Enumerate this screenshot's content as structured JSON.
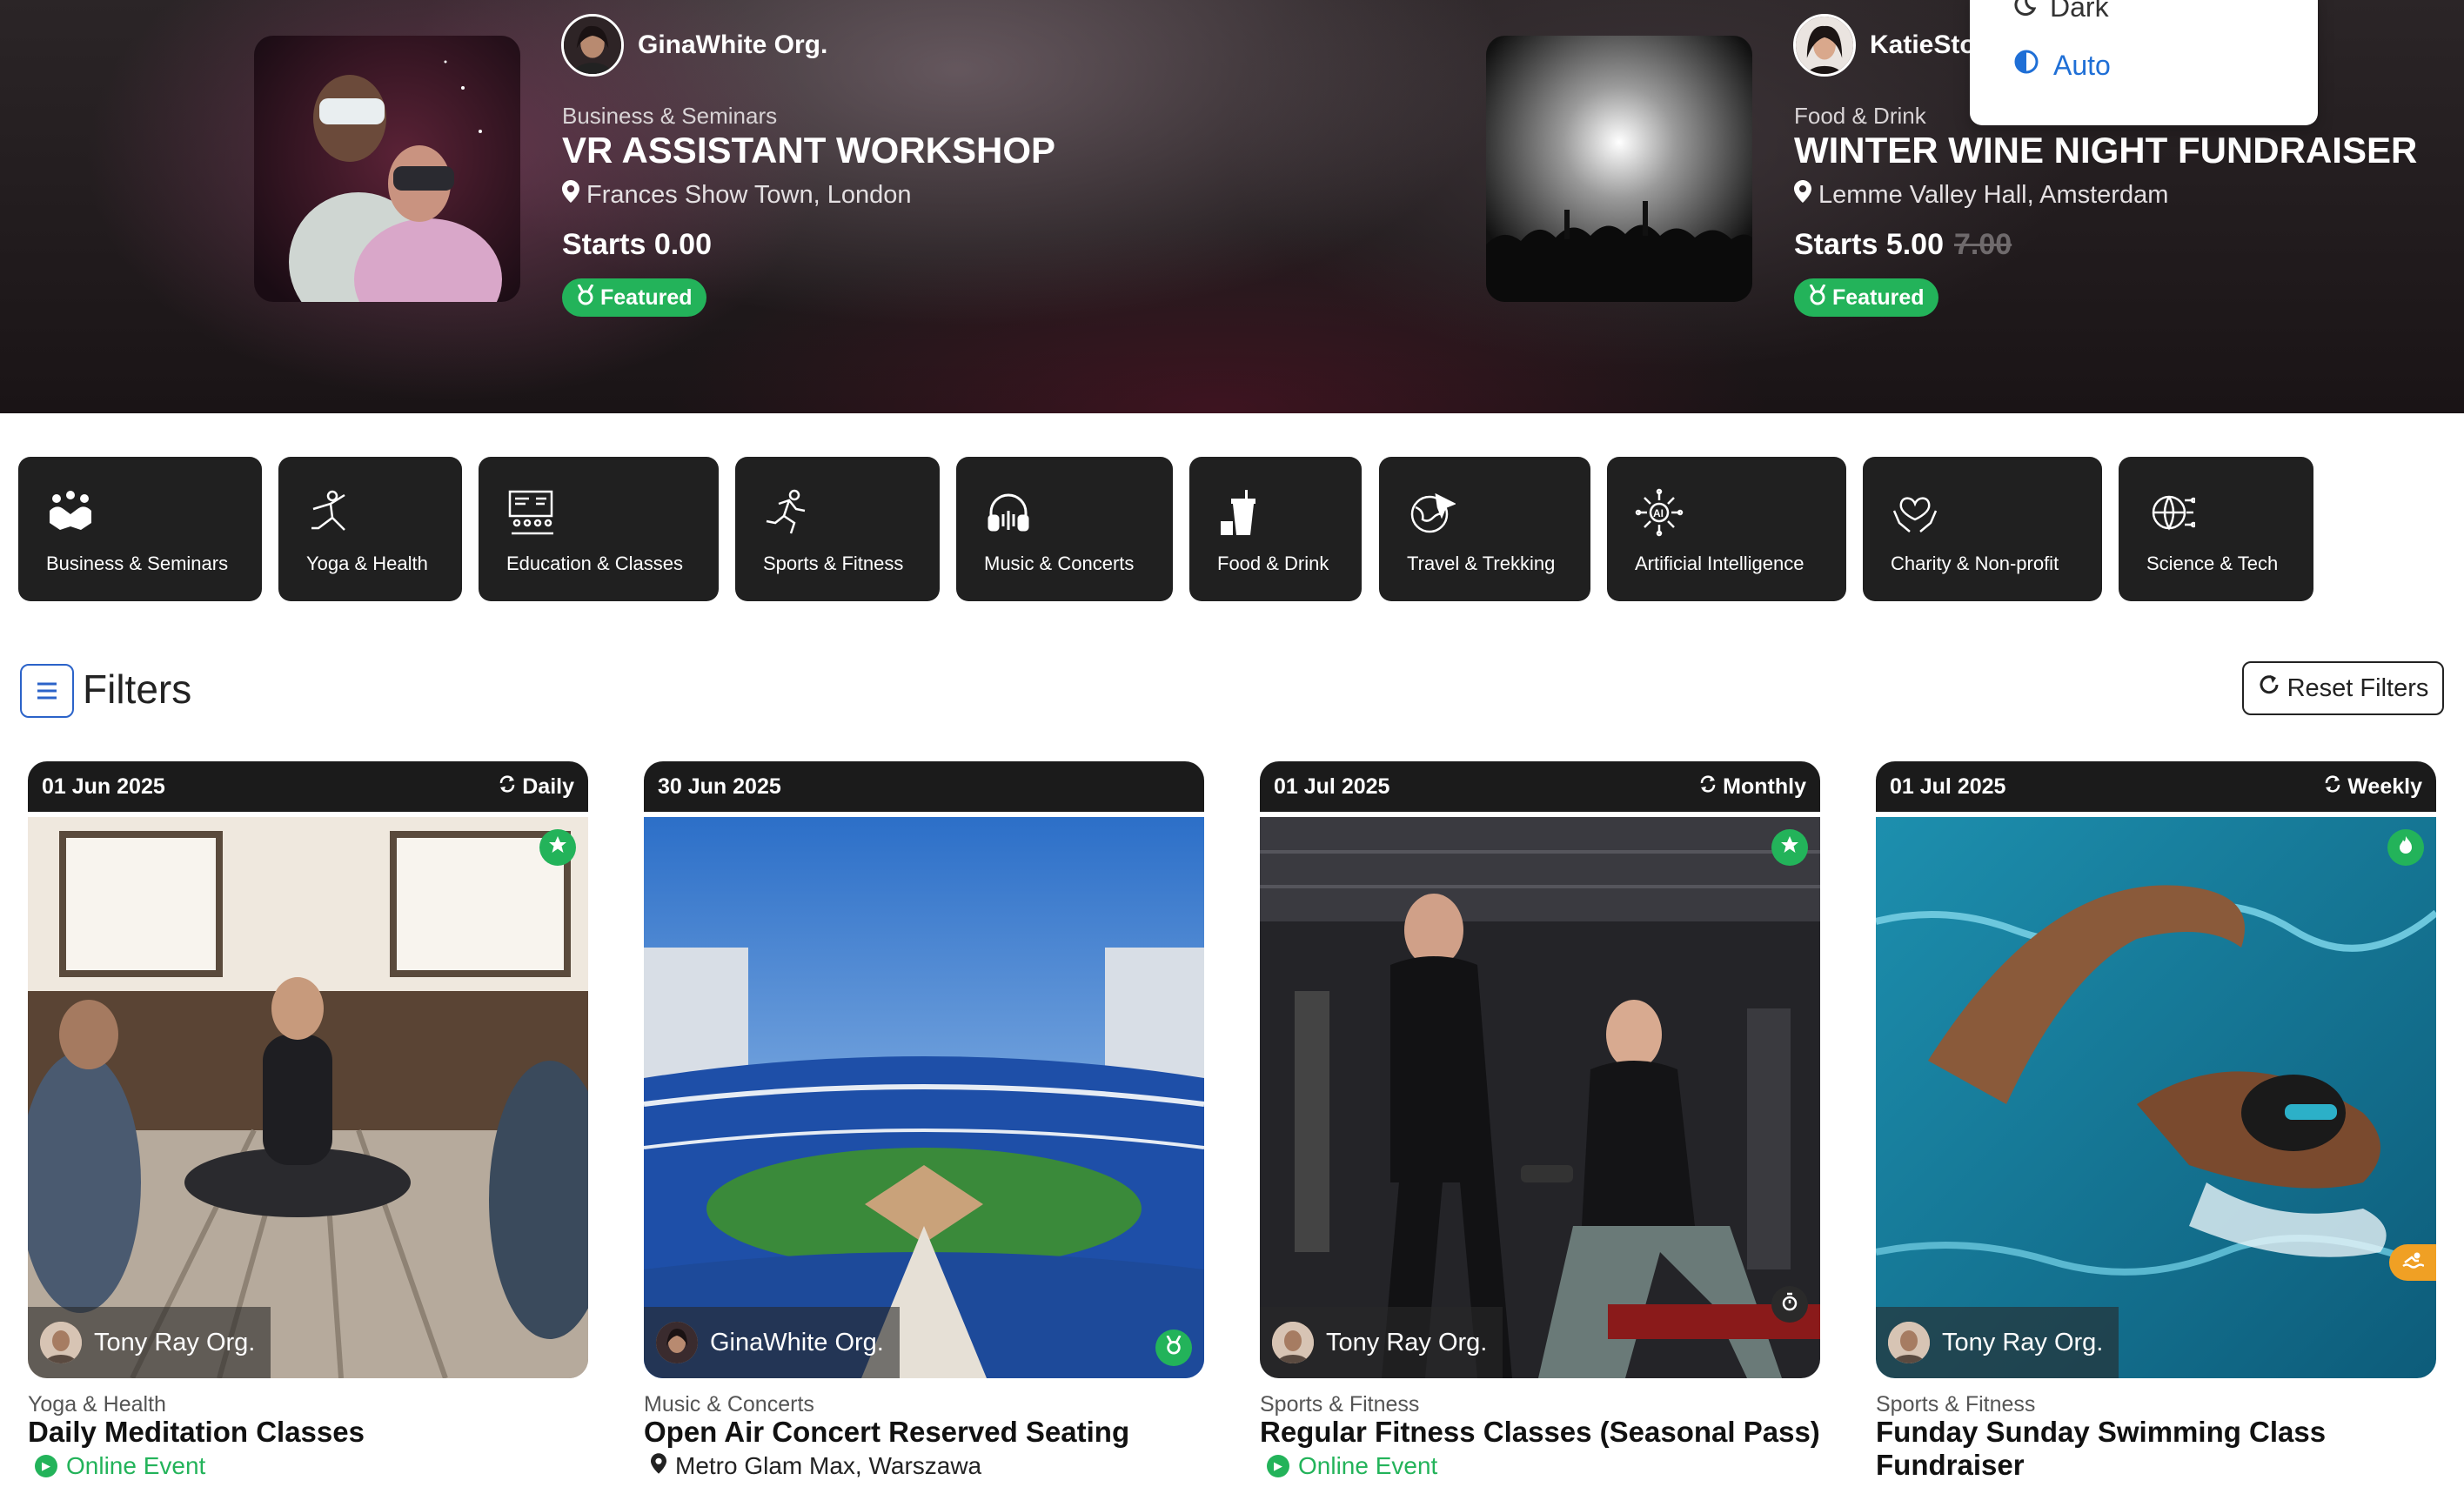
{
  "theme_menu": {
    "items": [
      {
        "label": "Dark",
        "icon": "moon-icon"
      },
      {
        "label": "Auto",
        "icon": "contrast-icon",
        "active": true
      }
    ]
  },
  "hero": {
    "slides": [
      {
        "organizer": "GinaWhite Org.",
        "category": "Business & Seminars",
        "title": "VR ASSISTANT WORKSHOP",
        "location": "Frances Show Town, London",
        "price": "Starts 0.00",
        "old_price": "",
        "badge": "Featured"
      },
      {
        "organizer": "KatieSto",
        "category": "Food & Drink",
        "title": "WINTER WINE NIGHT FUNDRAISER",
        "location": "Lemme Valley Hall, Amsterdam",
        "price": "Starts 5.00",
        "old_price": "7.00",
        "badge": "Featured"
      }
    ]
  },
  "categories": [
    {
      "label": "Business & Seminars",
      "icon": "handshake-icon"
    },
    {
      "label": "Yoga & Health",
      "icon": "yoga-icon"
    },
    {
      "label": "Education & Classes",
      "icon": "classroom-icon"
    },
    {
      "label": "Sports & Fitness",
      "icon": "runner-icon"
    },
    {
      "label": "Music & Concerts",
      "icon": "headphones-icon"
    },
    {
      "label": "Food & Drink",
      "icon": "drink-icon"
    },
    {
      "label": "Travel & Trekking",
      "icon": "globe-plane-icon"
    },
    {
      "label": "Artificial Intelligence",
      "icon": "ai-chip-icon"
    },
    {
      "label": "Charity & Non-profit",
      "icon": "heart-hands-icon"
    },
    {
      "label": "Science & Tech",
      "icon": "tech-globe-icon"
    }
  ],
  "filters": {
    "title": "Filters",
    "reset_label": "Reset Filters"
  },
  "events": [
    {
      "date": "01 Jun 2025",
      "recurrence": "Daily",
      "organizer": "Tony Ray Org.",
      "category": "Yoga & Health",
      "title": "Daily Meditation Classes",
      "subtitle": "Online Event",
      "subtitle_type": "online"
    },
    {
      "date": "30 Jun 2025",
      "recurrence": "",
      "organizer": "GinaWhite Org.",
      "category": "Music & Concerts",
      "title": "Open Air Concert Reserved Seating",
      "subtitle": "Metro Glam Max, Warszawa",
      "subtitle_type": "venue"
    },
    {
      "date": "01 Jul 2025",
      "recurrence": "Monthly",
      "organizer": "Tony Ray Org.",
      "category": "Sports & Fitness",
      "title": "Regular Fitness Classes (Seasonal Pass)",
      "subtitle": "Online Event",
      "subtitle_type": "online"
    },
    {
      "date": "01 Jul 2025",
      "recurrence": "Weekly",
      "organizer": "Tony Ray Org.",
      "category": "Sports & Fitness",
      "title": "Funday Sunday Swimming Class Fundraiser",
      "subtitle": "",
      "subtitle_type": "none"
    }
  ],
  "colors": {
    "accent_green": "#23b35a",
    "accent_blue": "#1f6fd6",
    "tile_bg": "#202020",
    "badge_orange": "#f0a024"
  }
}
